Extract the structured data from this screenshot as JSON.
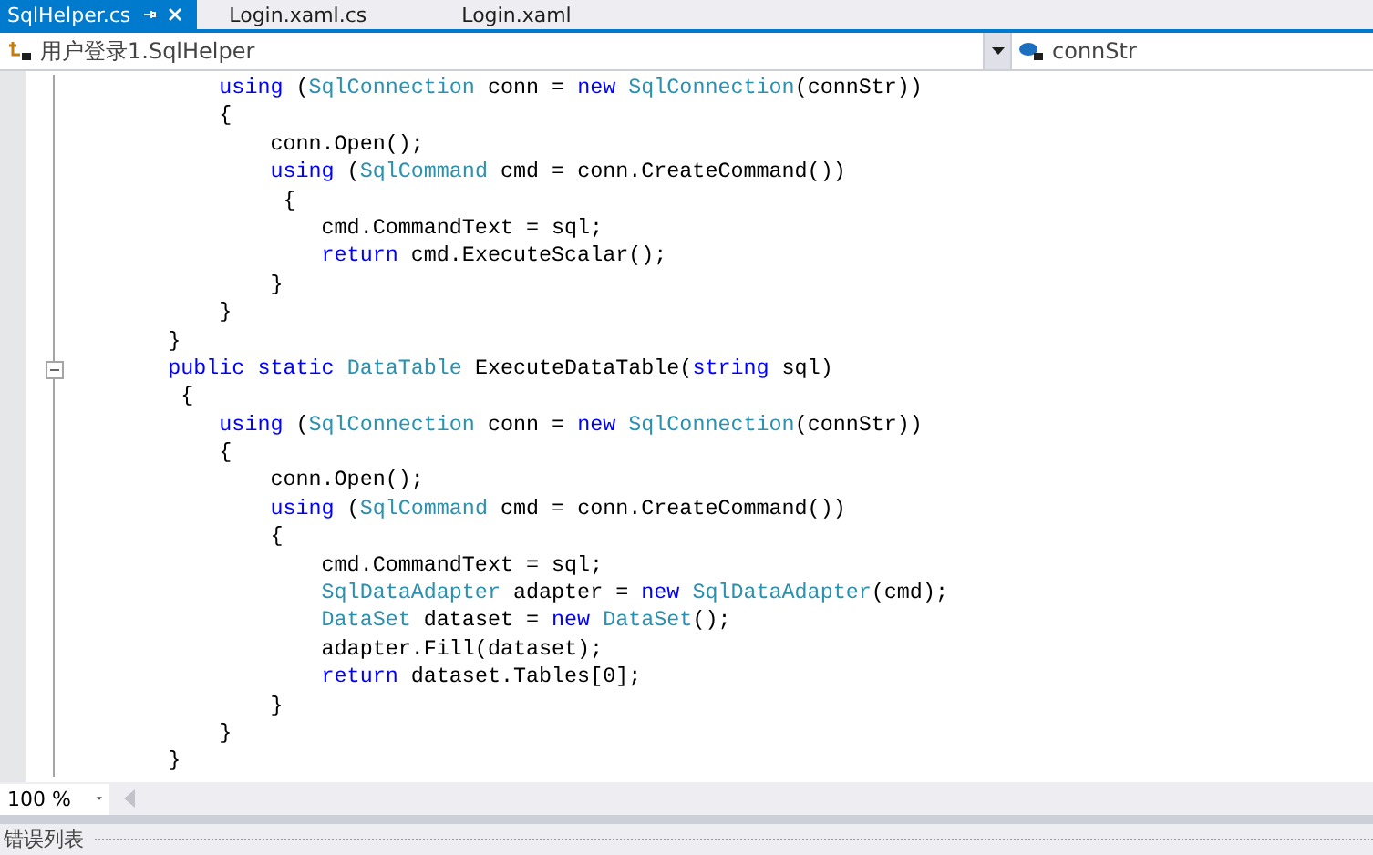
{
  "tabs": [
    {
      "label": "SqlHelper.cs",
      "selected": true,
      "pinned": true,
      "closable": true
    },
    {
      "label": "Login.xaml.cs",
      "selected": false,
      "pinned": false,
      "closable": false
    },
    {
      "label": "Login.xaml",
      "selected": false,
      "pinned": false,
      "closable": false
    }
  ],
  "navigation": {
    "type_dropdown": "用户登录1.SqlHelper",
    "member_dropdown": "connStr"
  },
  "code_lines": [
    {
      "toggle": false,
      "segments": [
        {
          "kind": "keyword",
          "text": "            using"
        },
        {
          "kind": "plain",
          "text": " ("
        },
        {
          "kind": "type",
          "text": "SqlConnection"
        },
        {
          "kind": "plain",
          "text": " conn = "
        },
        {
          "kind": "keyword",
          "text": "new "
        },
        {
          "kind": "type",
          "text": "SqlConnection"
        },
        {
          "kind": "plain",
          "text": "(connStr))"
        }
      ]
    },
    {
      "toggle": false,
      "segments": [
        {
          "kind": "plain",
          "text": "            {"
        }
      ]
    },
    {
      "toggle": false,
      "segments": [
        {
          "kind": "plain",
          "text": "                conn.Open();"
        }
      ]
    },
    {
      "toggle": false,
      "segments": [
        {
          "kind": "keyword",
          "text": "                using"
        },
        {
          "kind": "plain",
          "text": " ("
        },
        {
          "kind": "type",
          "text": "SqlCommand"
        },
        {
          "kind": "plain",
          "text": " cmd = conn.CreateCommand())"
        }
      ]
    },
    {
      "toggle": false,
      "segments": [
        {
          "kind": "plain",
          "text": "                 {"
        }
      ]
    },
    {
      "toggle": false,
      "segments": [
        {
          "kind": "plain",
          "text": "                    cmd.CommandText = sql;"
        }
      ]
    },
    {
      "toggle": false,
      "segments": [
        {
          "kind": "keyword",
          "text": "                    return"
        },
        {
          "kind": "plain",
          "text": " cmd.ExecuteScalar();"
        }
      ]
    },
    {
      "toggle": false,
      "segments": [
        {
          "kind": "plain",
          "text": "                }"
        }
      ]
    },
    {
      "toggle": false,
      "segments": [
        {
          "kind": "plain",
          "text": "            }"
        }
      ]
    },
    {
      "toggle": false,
      "segments": [
        {
          "kind": "plain",
          "text": "        }"
        }
      ]
    },
    {
      "toggle": true,
      "segments": [
        {
          "kind": "keyword",
          "text": "        public static "
        },
        {
          "kind": "type",
          "text": "DataTable"
        },
        {
          "kind": "plain",
          "text": " ExecuteDataTable("
        },
        {
          "kind": "keyword",
          "text": "string"
        },
        {
          "kind": "plain",
          "text": " sql)"
        }
      ]
    },
    {
      "toggle": false,
      "segments": [
        {
          "kind": "plain",
          "text": "         {"
        }
      ]
    },
    {
      "toggle": false,
      "segments": [
        {
          "kind": "keyword",
          "text": "            using"
        },
        {
          "kind": "plain",
          "text": " ("
        },
        {
          "kind": "type",
          "text": "SqlConnection"
        },
        {
          "kind": "plain",
          "text": " conn = "
        },
        {
          "kind": "keyword",
          "text": "new "
        },
        {
          "kind": "type",
          "text": "SqlConnection"
        },
        {
          "kind": "plain",
          "text": "(connStr))"
        }
      ]
    },
    {
      "toggle": false,
      "segments": [
        {
          "kind": "plain",
          "text": "            {"
        }
      ]
    },
    {
      "toggle": false,
      "segments": [
        {
          "kind": "plain",
          "text": "                conn.Open();"
        }
      ]
    },
    {
      "toggle": false,
      "segments": [
        {
          "kind": "keyword",
          "text": "                using"
        },
        {
          "kind": "plain",
          "text": " ("
        },
        {
          "kind": "type",
          "text": "SqlCommand"
        },
        {
          "kind": "plain",
          "text": " cmd = conn.CreateCommand())"
        }
      ]
    },
    {
      "toggle": false,
      "segments": [
        {
          "kind": "plain",
          "text": "                {"
        }
      ]
    },
    {
      "toggle": false,
      "segments": [
        {
          "kind": "plain",
          "text": "                    cmd.CommandText = sql;"
        }
      ]
    },
    {
      "toggle": false,
      "segments": [
        {
          "kind": "type",
          "text": "                    SqlDataAdapter"
        },
        {
          "kind": "plain",
          "text": " adapter = "
        },
        {
          "kind": "keyword",
          "text": "new "
        },
        {
          "kind": "type",
          "text": "SqlDataAdapter"
        },
        {
          "kind": "plain",
          "text": "(cmd);"
        }
      ]
    },
    {
      "toggle": false,
      "segments": [
        {
          "kind": "type",
          "text": "                    DataSet"
        },
        {
          "kind": "plain",
          "text": " dataset = "
        },
        {
          "kind": "keyword",
          "text": "new "
        },
        {
          "kind": "type",
          "text": "DataSet"
        },
        {
          "kind": "plain",
          "text": "();"
        }
      ]
    },
    {
      "toggle": false,
      "segments": [
        {
          "kind": "plain",
          "text": "                    adapter.Fill(dataset);"
        }
      ]
    },
    {
      "toggle": false,
      "segments": [
        {
          "kind": "keyword",
          "text": "                    return"
        },
        {
          "kind": "plain",
          "text": " dataset.Tables[0];"
        }
      ]
    },
    {
      "toggle": false,
      "segments": [
        {
          "kind": "plain",
          "text": "                }"
        }
      ]
    },
    {
      "toggle": false,
      "segments": [
        {
          "kind": "plain",
          "text": "            }"
        }
      ]
    },
    {
      "toggle": false,
      "segments": [
        {
          "kind": "plain",
          "text": "        }"
        }
      ]
    }
  ],
  "zoom": "100 %",
  "bottom_panel": {
    "title": "错误列表"
  }
}
